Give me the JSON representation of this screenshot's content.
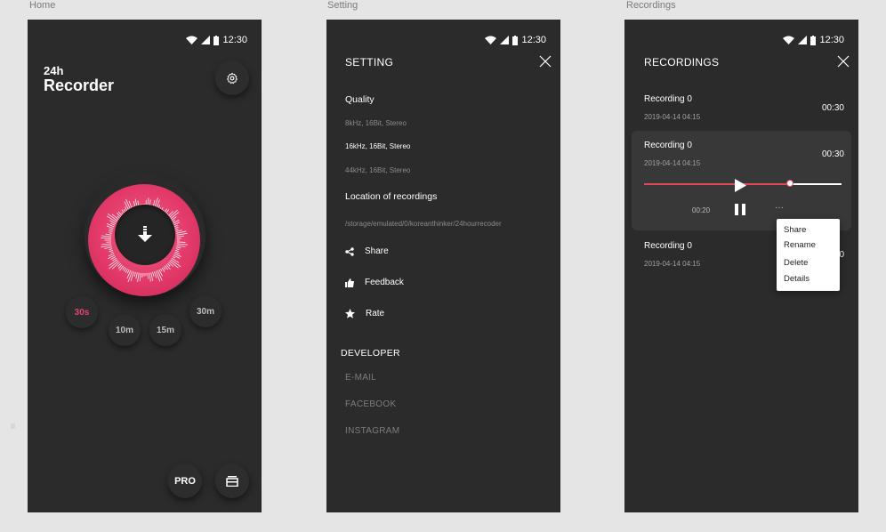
{
  "frames": {
    "home": "Home",
    "setting": "Setting",
    "recordings": "Recordings"
  },
  "status": {
    "time": "12:30"
  },
  "home": {
    "title_small": "24h",
    "title_big": "Recorder",
    "chips": [
      "30s",
      "10m",
      "15m",
      "30m"
    ],
    "active_chip": "30s",
    "pro_label": "PRO",
    "icons": {
      "settings": "gear-icon",
      "download": "download-arrow-icon",
      "library": "stack-icon"
    },
    "accent": "#e33a69"
  },
  "settings": {
    "title": "SETTING",
    "quality_label": "Quality",
    "quality_options": [
      "8kHz, 16Bit, Stereo",
      "16kHz, 16Bit, Stereo",
      "44kHz, 16Bit, Stereo"
    ],
    "selected_quality": "16kHz, 16Bit, Stereo",
    "location_label": "Location of recordings",
    "location_path": "/storage/emulated/0/koreanthinker/24hourrecoder",
    "actions": [
      "Share",
      "Feedback",
      "Rate"
    ],
    "developer_title": "DEVELOPER",
    "developer_links": [
      "E-MAIL",
      "FACEBOOK",
      "INSTAGRAM"
    ]
  },
  "recordings": {
    "title": "RECORDINGS",
    "items": [
      {
        "name": "Recording 0",
        "date": "2019-04-14 04:15",
        "duration": "00:30"
      },
      {
        "name": "Recording 0",
        "date": "2019-04-14 04:15",
        "duration": "00:30"
      },
      {
        "name": "Recording 0",
        "date": "2019-04-14 04:15",
        "duration": "0"
      }
    ],
    "player": {
      "elapsed": "00:20",
      "progress": 0.74,
      "more": "···"
    },
    "menu": [
      "Share",
      "Rename",
      "Delete",
      "Details"
    ],
    "accent": "#e0485a"
  }
}
